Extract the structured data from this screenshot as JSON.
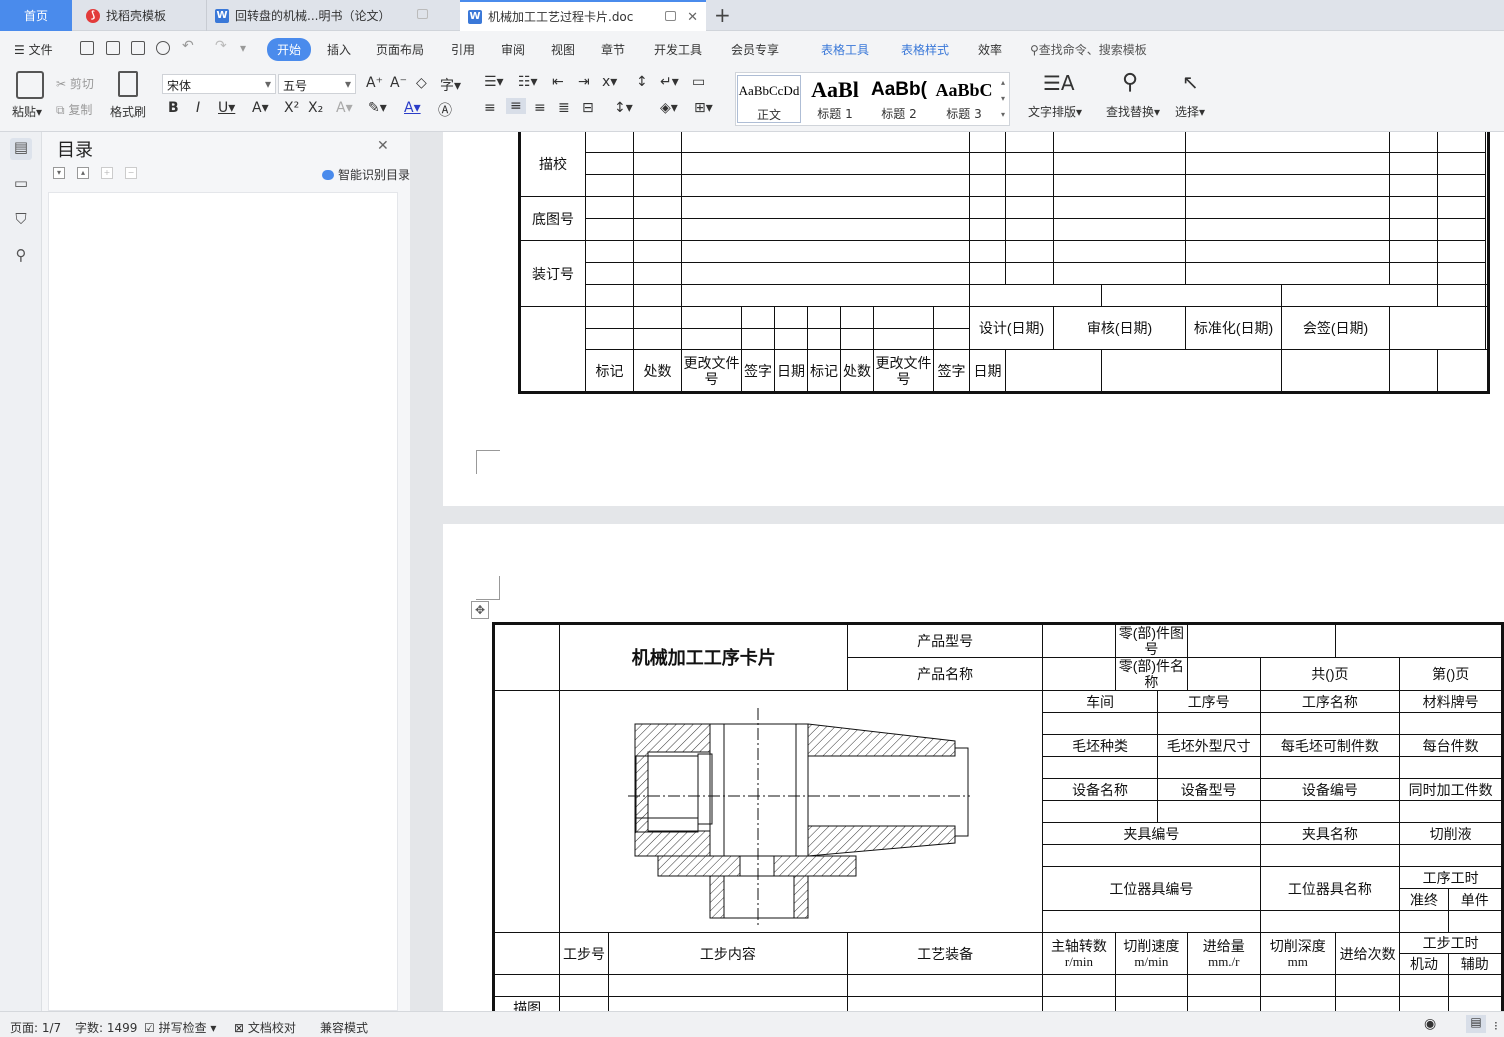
{
  "tabs": {
    "home": "首页",
    "t1": "找稻壳模板",
    "t2": "回转盘的机械...明书（论文）",
    "t3": "机械加工工艺过程卡片.doc",
    "new": "+",
    "close": "✕"
  },
  "menu": {
    "file": "文件",
    "start": "开始",
    "insert": "插入",
    "layout": "页面布局",
    "refs": "引用",
    "review": "审阅",
    "view": "视图",
    "chapter": "章节",
    "dev": "开发工具",
    "vip": "会员专享",
    "table_tools": "表格工具",
    "table_style": "表格样式",
    "efficiency": "效率",
    "search": "查找命令、搜索模板"
  },
  "ribbon": {
    "paste": "粘贴",
    "cut": "剪切",
    "copy": "复制",
    "format_painter": "格式刷",
    "font": "宋体",
    "size": "五号",
    "text_layout": "文字排版",
    "find_replace": "查找替换",
    "select": "选择",
    "styles": [
      {
        "sample": "AaBbCcDd",
        "label": "正文"
      },
      {
        "sample": "AaBl",
        "label": "标题 1"
      },
      {
        "sample": "AaBb(",
        "label": "标题 2"
      },
      {
        "sample": "AaBbC",
        "label": "标题 3"
      }
    ]
  },
  "toc": {
    "title": "目录",
    "smart": "智能识别目录",
    "close": "✕"
  },
  "status": {
    "page": "页面: 1/7",
    "words": "字数: 1499",
    "spell": "拼写检查",
    "doccheck": "文档校对",
    "compat": "兼容模式"
  },
  "sheet1": {
    "side": [
      "描校",
      "底图号",
      "装订号"
    ],
    "sign_headers": [
      "设计(日期)",
      "审核(日期)",
      "标准化(日期)",
      "会签(日期)"
    ],
    "bottom_row": [
      "标记",
      "处数",
      "更改文件号",
      "签字",
      "日期",
      "标记",
      "处数",
      "更改文件号",
      "签字",
      "日期"
    ]
  },
  "sheet2": {
    "title": "机械加工工序卡片",
    "product_model": "产品型号",
    "product_name": "产品名称",
    "part_no": "零(部)件图号",
    "part_name": "零(部)件名称",
    "total_pages": "共()页",
    "page_no": "第()页",
    "row_a": [
      "车间",
      "工序号",
      "工序名称",
      "材料牌号"
    ],
    "row_b": [
      "毛坯种类",
      "毛坯外型尺寸",
      "每毛坯可制件数",
      "每台件数"
    ],
    "row_c": [
      "设备名称",
      "设备型号",
      "设备编号",
      "同时加工件数"
    ],
    "row_d": [
      "夹具编号",
      "夹具名称",
      "切削液"
    ],
    "row_e": [
      "工位器具编号",
      "工位器具名称",
      "工序工时"
    ],
    "row_e_sub": [
      "准终",
      "单件"
    ],
    "step_headers": [
      "工步号",
      "工步内容",
      "工艺装备",
      "主轴转数",
      "切削速度",
      "进给量",
      "切削深度",
      "进给次数",
      "工步工时"
    ],
    "step_units": [
      "r/min",
      "m/min",
      "mm./r",
      "mm"
    ],
    "step_time_sub": [
      "机动",
      "辅助"
    ],
    "side_label": "描图"
  }
}
